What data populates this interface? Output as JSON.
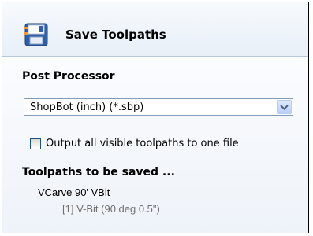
{
  "header": {
    "title": "Save Toolpaths",
    "icon": "save-toolpaths-icon"
  },
  "post_processor": {
    "label": "Post Processor",
    "selected": "ShopBot (inch) (*.sbp)"
  },
  "output_option": {
    "label": "Output all visible toolpaths to one file",
    "checked": false
  },
  "toolpaths": {
    "heading": "Toolpaths to be saved ...",
    "items": [
      {
        "name": "VCarve 90' VBit",
        "tool": "[1] V-Bit (90 deg 0.5\")"
      }
    ]
  },
  "colors": {
    "tool_text": "#707070",
    "border": "#7f9db9"
  }
}
